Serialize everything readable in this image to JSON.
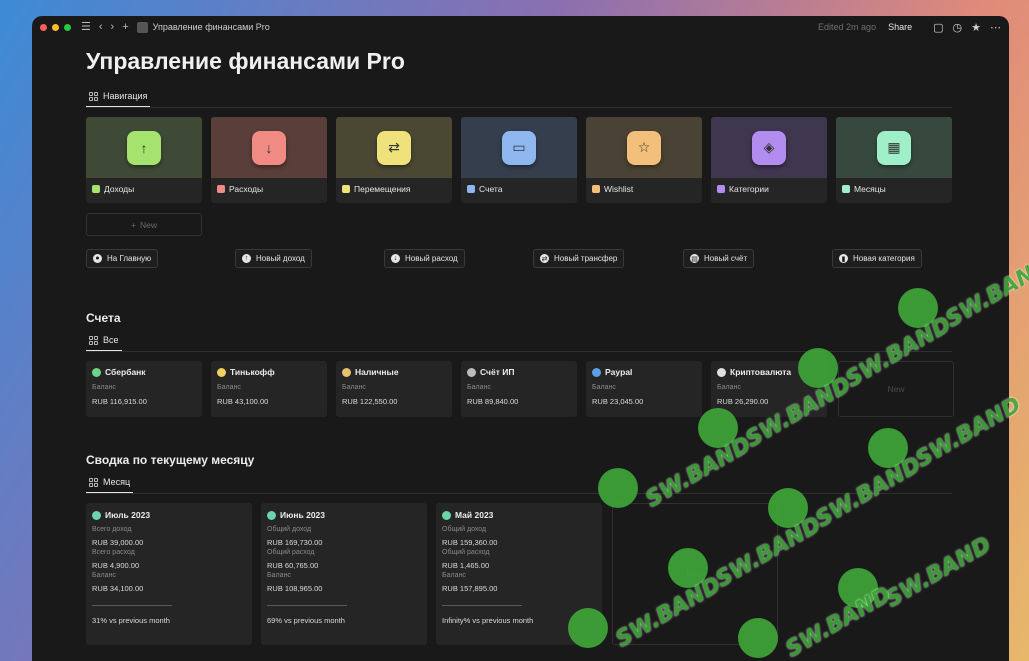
{
  "topbar": {
    "page_name": "Управление финансами Pro",
    "edited": "Edited 2m ago",
    "share": "Share"
  },
  "page": {
    "title": "Управление финансами Pro"
  },
  "nav_view": {
    "tab": "Навигация"
  },
  "nav_cards": [
    {
      "label": "Доходы",
      "glyph": "↑",
      "color": "#a5e36f",
      "cover": "#3f4a36"
    },
    {
      "label": "Расходы",
      "glyph": "↓",
      "color": "#f08b84",
      "cover": "#5a3e39"
    },
    {
      "label": "Перемещения",
      "glyph": "⇄",
      "color": "#f0e27a",
      "cover": "#4a4733"
    },
    {
      "label": "Счета",
      "glyph": "▭",
      "color": "#8fb7ef",
      "cover": "#353e4d"
    },
    {
      "label": "Wishlist",
      "glyph": "☆",
      "color": "#f2c07a",
      "cover": "#4b4236"
    },
    {
      "label": "Категории",
      "glyph": "◈",
      "color": "#b38cf0",
      "cover": "#3f3650"
    },
    {
      "label": "Месяцы",
      "glyph": "▦",
      "color": "#9ff0c8",
      "cover": "#37493f"
    }
  ],
  "new_label": "New",
  "actions": [
    {
      "label": "На Главную",
      "icon": "dot-icon"
    },
    {
      "label": "Новый доход",
      "icon": "arrow-up-icon"
    },
    {
      "label": "Новый расход",
      "icon": "arrow-down-icon"
    },
    {
      "label": "Новый трансфер",
      "icon": "transfer-icon"
    },
    {
      "label": "Новый счёт",
      "icon": "wallet-icon"
    },
    {
      "label": "Новая категория",
      "icon": "bookmark-icon"
    }
  ],
  "accounts": {
    "title": "Счета",
    "view_tab": "Все",
    "items": [
      {
        "name": "Сбербанк",
        "label": "Баланс",
        "value": "RUB 116,915.00",
        "color": "#6dd38a"
      },
      {
        "name": "Тинькофф",
        "label": "Баланс",
        "value": "RUB 43,100.00",
        "color": "#f0d060"
      },
      {
        "name": "Наличные",
        "label": "Баланс",
        "value": "RUB 122,550.00",
        "color": "#e8c070"
      },
      {
        "name": "Счёт ИП",
        "label": "Баланс",
        "value": "RUB 89,840.00",
        "color": "#bbbbbb"
      },
      {
        "name": "Paypal",
        "label": "Баланс",
        "value": "RUB 23,045.00",
        "color": "#5aa0e6"
      },
      {
        "name": "Криптовалюта",
        "label": "Баланс",
        "value": "RUB 26,290.00",
        "color": "#e0e0e0"
      }
    ],
    "new_label": "New"
  },
  "summary": {
    "title": "Сводка по текущему месяцу",
    "view_tab": "Месяц",
    "months": [
      {
        "name": "Июль 2023",
        "l1": "Всего доход",
        "v1": "RUB 39,000.00",
        "l2": "Всего расход",
        "v2": "RUB 4,900.00",
        "l3": "Баланс",
        "v3": "RUB 34,100.00",
        "cmp": "31% vs previous month"
      },
      {
        "name": "Июнь 2023",
        "l1": "Общий доход",
        "v1": "RUB 169,730.00",
        "l2": "Общий расход",
        "v2": "RUB 60,765.00",
        "l3": "Баланс",
        "v3": "RUB 108,965.00",
        "cmp": "69% vs previous month"
      },
      {
        "name": "Май 2023",
        "l1": "Общий доход",
        "v1": "RUB 159,360.00",
        "l2": "Общий расход",
        "v2": "RUB 1,465.00",
        "l3": "Баланс",
        "v3": "RUB 157,895.00",
        "cmp": "Infinity% vs previous month"
      }
    ],
    "new_label": "New"
  },
  "watermark": {
    "text": "SW.BAND"
  }
}
